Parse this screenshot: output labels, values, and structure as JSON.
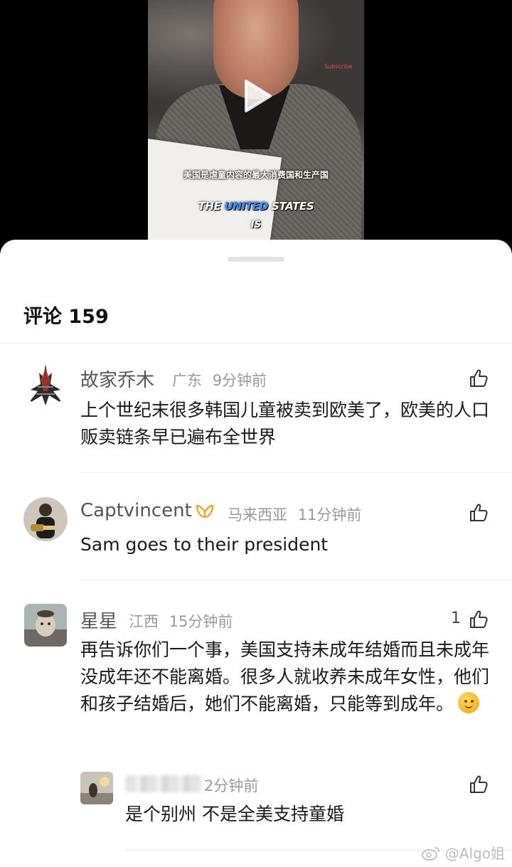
{
  "video": {
    "watermark_text": "Subscribe",
    "subtitle_cn": "美国是虐童内容的最大消费国和生产国",
    "subtitle_en_pre": "THE ",
    "subtitle_en_highlight": "UNITED",
    "subtitle_en_post": " STATES",
    "subtitle_en_line2": "IS"
  },
  "comments_header": "评论 159",
  "comments": [
    {
      "username": "故家乔木",
      "location": "广东",
      "time": "9分钟前",
      "text": "上个世纪末很多韩国儿童被卖到欧美了，欧美的人口贩卖链条早已遍布全世界",
      "likes": ""
    },
    {
      "username": "Captvincent",
      "location": "马来西亚",
      "time": "11分钟前",
      "text": "Sam goes to their president",
      "likes": ""
    },
    {
      "username": "星星",
      "location": "江西",
      "time": "15分钟前",
      "text": "再告诉你们一个事，美国支持未成年结婚而且未成年没成年还不能离婚。很多人就收养未成年女性，他们和孩子结婚后，她们不能离婚，只能等到成年。",
      "likes": "1"
    }
  ],
  "reply": {
    "time": "2分钟前",
    "text": "是个别州 不是全美支持童婚"
  },
  "watermark": "@Algo姐",
  "icons": {
    "play": "play-icon",
    "like": "thumbs-up-icon",
    "badge": "vip-badge-icon",
    "weibo": "weibo-logo-icon"
  }
}
